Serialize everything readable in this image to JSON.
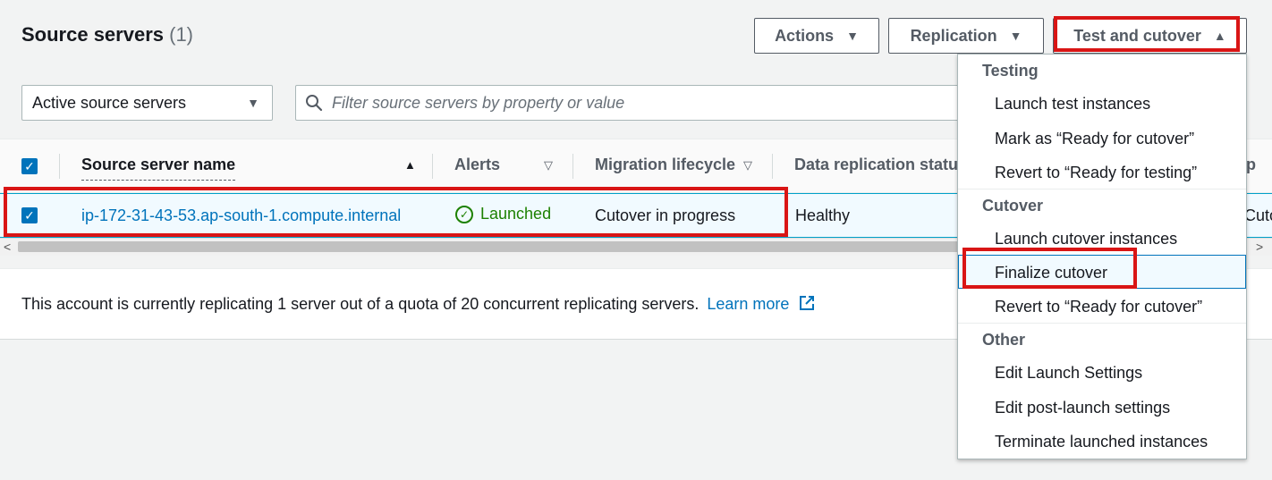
{
  "header": {
    "title": "Source servers",
    "count": "(1)",
    "buttons": {
      "actions": "Actions",
      "replication": "Replication",
      "test_and_cutover": "Test and cutover"
    }
  },
  "filter": {
    "selected": "Active source servers",
    "placeholder": "Filter source servers by property or value"
  },
  "table": {
    "columns": [
      "Source server name",
      "Alerts",
      "Migration lifecycle",
      "Data replication status"
    ],
    "rows": [
      {
        "name": "ip-172-31-43-53.ap-south-1.compute.internal",
        "alerts": "Launched",
        "lifecycle": "Cutover in progress",
        "replication": "Healthy",
        "next": "Cuto"
      }
    ],
    "truncated_header": "p"
  },
  "info": {
    "text": "This account is currently replicating 1 server out of a quota of 20 concurrent replicating servers.",
    "link": "Learn more"
  },
  "menu": {
    "testing_label": "Testing",
    "testing_items": [
      "Launch test instances",
      "Mark as “Ready for cutover”",
      "Revert to “Ready for testing”"
    ],
    "cutover_label": "Cutover",
    "cutover_items": [
      "Launch cutover instances",
      "Finalize cutover",
      "Revert to “Ready for cutover”"
    ],
    "other_label": "Other",
    "other_items": [
      "Edit Launch Settings",
      "Edit post-launch settings",
      "Terminate launched instances"
    ]
  },
  "colors": {
    "link": "#0073bb",
    "success": "#1d8102",
    "highlight": "#d91515"
  }
}
